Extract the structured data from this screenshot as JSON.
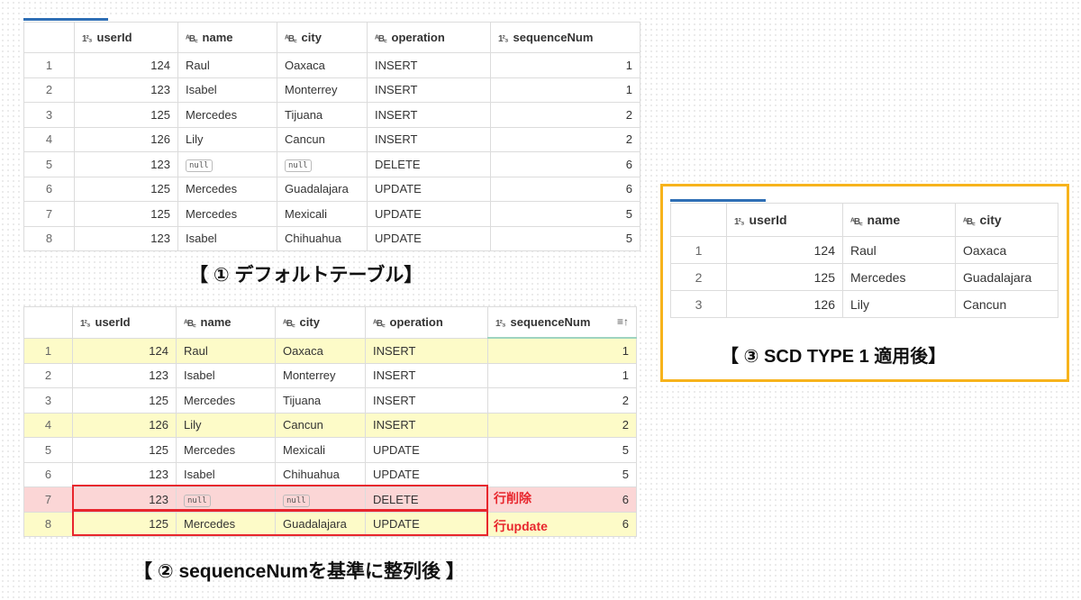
{
  "columns": {
    "userid": "userId",
    "name": "name",
    "city": "city",
    "operation": "operation",
    "sequencenum": "sequenceNum"
  },
  "icons": {
    "numeric": "numeric-type-icon",
    "text": "text-type-icon",
    "sort": "sort-ascending-icon"
  },
  "type_icons": {
    "numeric": "1²₃",
    "text": "ᴬB꜀"
  },
  "sort_glyph": "≡↑",
  "colors": {
    "highlight_yellow": "#fdfbc8",
    "highlight_pink": "#fbd6d6",
    "red": "#e8262d",
    "orange_frame": "#f7b31c",
    "accent_blue": "#2f6fb5"
  },
  "table1": {
    "caption": "【 ① デフォルトテーブル】",
    "rows": [
      {
        "idx": "1",
        "userId": "124",
        "name": "Raul",
        "city": "Oaxaca",
        "operation": "INSERT",
        "seq": "1"
      },
      {
        "idx": "2",
        "userId": "123",
        "name": "Isabel",
        "city": "Monterrey",
        "operation": "INSERT",
        "seq": "1"
      },
      {
        "idx": "3",
        "userId": "125",
        "name": "Mercedes",
        "city": "Tijuana",
        "operation": "INSERT",
        "seq": "2"
      },
      {
        "idx": "4",
        "userId": "126",
        "name": "Lily",
        "city": "Cancun",
        "operation": "INSERT",
        "seq": "2"
      },
      {
        "idx": "5",
        "userId": "123",
        "name": "null",
        "city": "null",
        "operation": "DELETE",
        "seq": "6"
      },
      {
        "idx": "6",
        "userId": "125",
        "name": "Mercedes",
        "city": "Guadalajara",
        "operation": "UPDATE",
        "seq": "6"
      },
      {
        "idx": "7",
        "userId": "125",
        "name": "Mercedes",
        "city": "Mexicali",
        "operation": "UPDATE",
        "seq": "5"
      },
      {
        "idx": "8",
        "userId": "123",
        "name": "Isabel",
        "city": "Chihuahua",
        "operation": "UPDATE",
        "seq": "5"
      }
    ]
  },
  "table2": {
    "caption": "【 ② sequenceNumを基準に整列後 】",
    "rows": [
      {
        "idx": "1",
        "userId": "124",
        "name": "Raul",
        "city": "Oaxaca",
        "operation": "INSERT",
        "seq": "1",
        "highlight": "yellow"
      },
      {
        "idx": "2",
        "userId": "123",
        "name": "Isabel",
        "city": "Monterrey",
        "operation": "INSERT",
        "seq": "1",
        "highlight": ""
      },
      {
        "idx": "3",
        "userId": "125",
        "name": "Mercedes",
        "city": "Tijuana",
        "operation": "INSERT",
        "seq": "2",
        "highlight": ""
      },
      {
        "idx": "4",
        "userId": "126",
        "name": "Lily",
        "city": "Cancun",
        "operation": "INSERT",
        "seq": "2",
        "highlight": "yellow"
      },
      {
        "idx": "5",
        "userId": "125",
        "name": "Mercedes",
        "city": "Mexicali",
        "operation": "UPDATE",
        "seq": "5",
        "highlight": ""
      },
      {
        "idx": "6",
        "userId": "123",
        "name": "Isabel",
        "city": "Chihuahua",
        "operation": "UPDATE",
        "seq": "5",
        "highlight": ""
      },
      {
        "idx": "7",
        "userId": "123",
        "name": "null",
        "city": "null",
        "operation": "DELETE",
        "seq": "6",
        "highlight": "pink"
      },
      {
        "idx": "8",
        "userId": "125",
        "name": "Mercedes",
        "city": "Guadalajara",
        "operation": "UPDATE",
        "seq": "6",
        "highlight": "yellow"
      }
    ],
    "annotations": {
      "delete": "行削除",
      "update": "行update"
    }
  },
  "table3": {
    "caption": "【 ③ SCD TYPE 1 適用後】",
    "rows": [
      {
        "idx": "1",
        "userId": "124",
        "name": "Raul",
        "city": "Oaxaca"
      },
      {
        "idx": "2",
        "userId": "125",
        "name": "Mercedes",
        "city": "Guadalajara"
      },
      {
        "idx": "3",
        "userId": "126",
        "name": "Lily",
        "city": "Cancun"
      }
    ]
  }
}
